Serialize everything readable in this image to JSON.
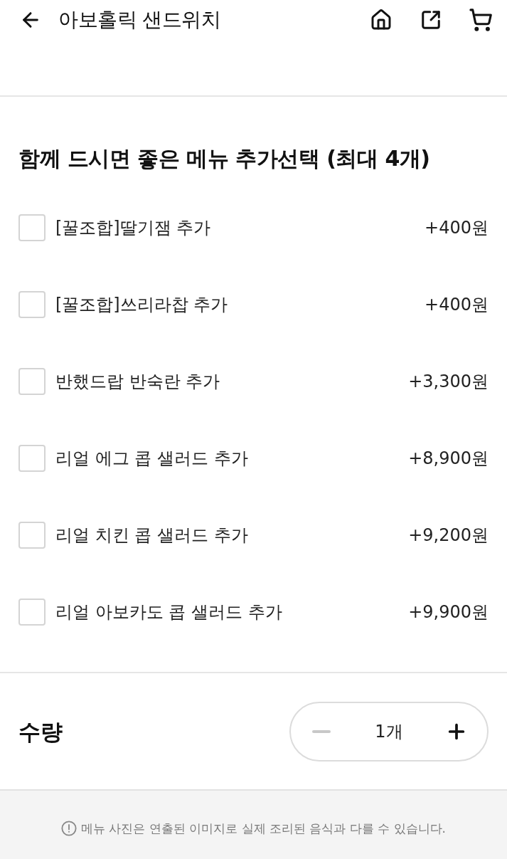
{
  "header": {
    "title": "아보홀릭 샌드위치"
  },
  "option_group": {
    "title": "함께 드시면 좋은 메뉴 추가선택 (최대 4개)",
    "options": [
      {
        "name": "[꿀조합]딸기잼 추가",
        "price": "+400원",
        "checked": false
      },
      {
        "name": "[꿀조합]쓰리라찹 추가",
        "price": "+400원",
        "checked": false
      },
      {
        "name": "반했드랍 반숙란 추가",
        "price": "+3,300원",
        "checked": false
      },
      {
        "name": "리얼 에그 콥 샐러드 추가",
        "price": "+8,900원",
        "checked": false
      },
      {
        "name": "리얼 치킨 콥 샐러드 추가",
        "price": "+9,200원",
        "checked": false
      },
      {
        "name": "리얼 아보카도 콥 샐러드 추가",
        "price": "+9,900원",
        "checked": false
      }
    ]
  },
  "quantity": {
    "label": "수량",
    "value": "1개",
    "decrease_disabled": true
  },
  "notice": {
    "text": "메뉴 사진은 연출된 이미지로 실제 조리된 음식과 다를 수 있습니다."
  }
}
